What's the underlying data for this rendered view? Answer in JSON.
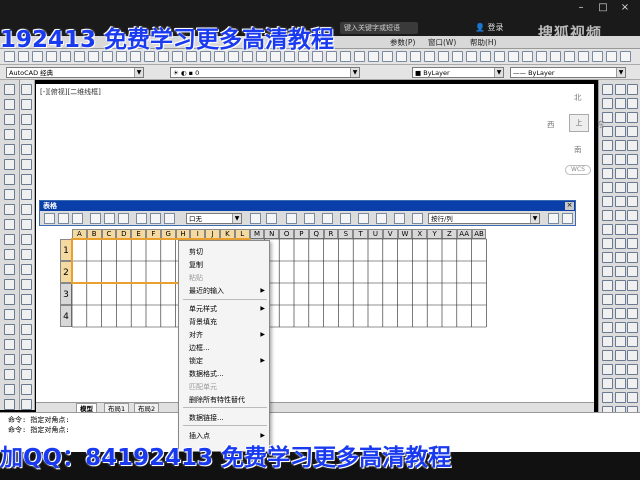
{
  "titlebar": {
    "search_placeholder": "键入关键字或短语",
    "login_label": "登录",
    "brand": "搜狐视频"
  },
  "menubar": {
    "items": [
      "参数(P)",
      "窗口(W)",
      "帮助(H)"
    ]
  },
  "toolbar2": {
    "workspace": "AutoCAD 经典",
    "layer": "0",
    "color": "ByLayer",
    "linetype": "ByLayer"
  },
  "drawing": {
    "viewport_label": "[-][俯视][二维线框]",
    "viewcube": {
      "north": "北",
      "south": "南",
      "east": "东",
      "west": "西",
      "face": "上",
      "wcs": "WCS"
    },
    "grid": {
      "columns": [
        "A",
        "B",
        "C",
        "D",
        "E",
        "F",
        "G",
        "H",
        "I",
        "J",
        "K",
        "L",
        "M",
        "N",
        "O",
        "P",
        "Q",
        "R",
        "S",
        "T",
        "U",
        "V",
        "W",
        "X",
        "Y",
        "Z",
        "AA",
        "AB"
      ],
      "rows": [
        "1",
        "2",
        "3",
        "4"
      ]
    }
  },
  "table_toolbar": {
    "title": "表格",
    "border_combo": "口无",
    "row_col_combo": "按行/列"
  },
  "context_menu": {
    "items": [
      {
        "label": "剪切",
        "disabled": false,
        "submenu": false
      },
      {
        "label": "复制",
        "disabled": false,
        "submenu": false
      },
      {
        "label": "粘贴",
        "disabled": true,
        "submenu": false
      },
      {
        "label": "最近的输入",
        "disabled": false,
        "submenu": true
      },
      {
        "label": "单元样式",
        "disabled": false,
        "submenu": true
      },
      {
        "label": "背景填充",
        "disabled": false,
        "submenu": false
      },
      {
        "label": "对齐",
        "disabled": false,
        "submenu": true
      },
      {
        "label": "边框...",
        "disabled": false,
        "submenu": false
      },
      {
        "label": "锁定",
        "disabled": false,
        "submenu": true
      },
      {
        "label": "数据格式...",
        "disabled": false,
        "submenu": false
      },
      {
        "label": "匹配单元",
        "disabled": true,
        "submenu": false
      },
      {
        "label": "删除所有特性替代",
        "disabled": false,
        "submenu": false
      },
      {
        "label": "数据链接...",
        "disabled": false,
        "submenu": false
      },
      {
        "label": "插入点",
        "disabled": false,
        "submenu": true
      }
    ]
  },
  "layout_tabs": [
    "模型",
    "布局1",
    "布局2"
  ],
  "command": {
    "lines": [
      "命令: 指定对角点:",
      "命令: 指定对角点:"
    ]
  },
  "watermarks": {
    "top": "192413 免费学习更多高清教程",
    "bottom": "加QQ：84192413 免费学习更多高清教程"
  },
  "colors": {
    "title_bar": "#1a1a1a",
    "table_toolbar_title": "#0a3ea8",
    "watermark": "#1a3af0",
    "selected_cell": "#f4d9a0"
  }
}
